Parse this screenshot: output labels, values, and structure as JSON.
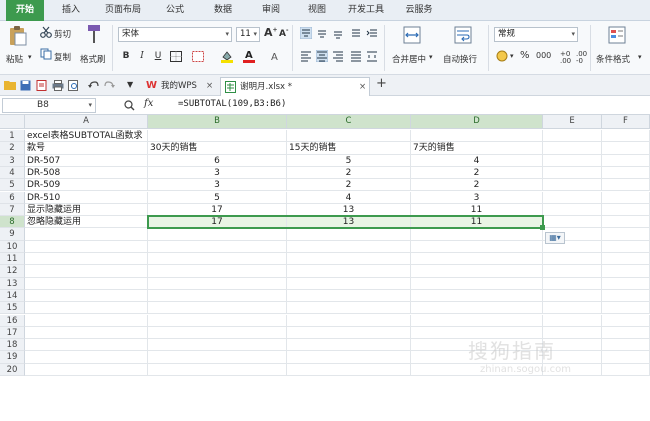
{
  "ribbon_tabs": [
    "开始",
    "插入",
    "页面布局",
    "公式",
    "数据",
    "审阅",
    "视图",
    "开发工具",
    "云服务"
  ],
  "active_tab": "开始",
  "clipboard": {
    "paste": "粘贴",
    "cut": "剪切",
    "copy": "复制",
    "format_painter": "格式刷"
  },
  "font": {
    "name": "宋体",
    "size": "11"
  },
  "font_buttons": {
    "bold": "B",
    "italic": "I",
    "underline": "U",
    "grow": "A",
    "shrink": "A"
  },
  "alignment": {
    "merge_center": "合并居中",
    "wrap": "自动换行"
  },
  "number": {
    "format": "常规",
    "percent": "%",
    "thousands": "000"
  },
  "styles": {
    "conditional": "条件格式"
  },
  "doc_tabs": [
    {
      "label": "我的WPS",
      "active": false
    },
    {
      "label": "谢明月.xlsx *",
      "active": true
    }
  ],
  "formula_bar": {
    "cell_ref": "B8",
    "fx": "fx",
    "formula": "=SUBTOTAL(109,B3:B6)"
  },
  "columns": [
    "A",
    "B",
    "C",
    "D",
    "E",
    "F"
  ],
  "rows": [
    [
      "excel表格SUBTOTAL函数求",
      "",
      "",
      ""
    ],
    [
      "款号",
      "30天的销售",
      "15天的销售",
      "7天的销售"
    ],
    [
      "DR-507",
      "6",
      "5",
      "4"
    ],
    [
      "DR-508",
      "3",
      "2",
      "2"
    ],
    [
      "DR-509",
      "3",
      "2",
      "2"
    ],
    [
      "DR-510",
      "5",
      "4",
      "3"
    ],
    [
      "显示隐藏运用",
      "17",
      "13",
      "11"
    ],
    [
      "忽略隐藏运用",
      "17",
      "13",
      "11"
    ]
  ],
  "row_count": 20,
  "selected_row": 8,
  "watermark": {
    "title": "搜狗指南",
    "url": "zhinan.sogou.com"
  }
}
